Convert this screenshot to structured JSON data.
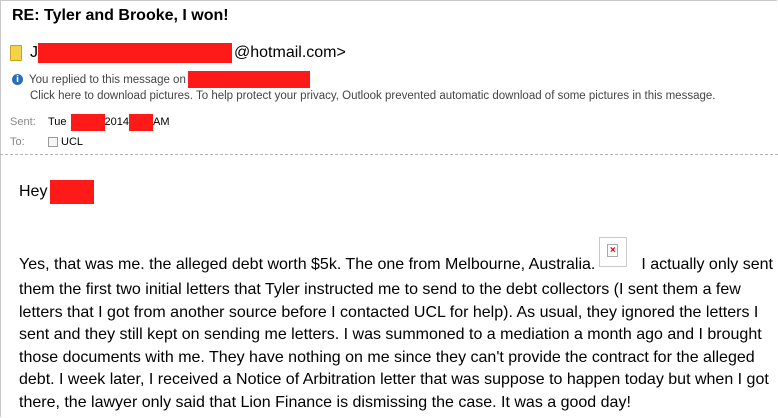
{
  "email": {
    "subject": "RE: Tyler and Brooke, I won!",
    "from_prefix": "J",
    "from_suffix": "@hotmail.com>",
    "info_replied": "You replied to this message on",
    "info_pictures": "Click here to download pictures. To help protect your privacy, Outlook prevented automatic download of some pictures in this message.",
    "sent_label": "Sent:",
    "sent_day": "Tue",
    "sent_year": "2014",
    "sent_ampm": "AM",
    "to_label": "To:",
    "to_value": "UCL",
    "greeting": "Hey",
    "body_line1_a": "Yes, that was me. the alleged debt worth $5k. The one from Melbourne, Australia.",
    "body_line1_b": "I actually only sent",
    "body_lines": [
      "them the first two initial letters that Tyler instructed me to send to the debt collectors (I sent them a few",
      "letters that I got from another source before I contacted UCL for help). As usual, they ignored the letters I",
      "sent and they still kept on sending me letters. I was  summoned to a mediation a month ago and I brought",
      "those documents with me. They have nothing on me since they can't provide the contract for the alleged",
      "debt. I week later, I received a Notice of Arbitration letter that was suppose to happen today but when I got",
      "there, the lawyer only said that Lion Finance is dismissing the case. It was a good day!"
    ]
  },
  "colors": {
    "redaction": "#ff1a1a",
    "info_icon": "#2a6db5"
  },
  "icons": [
    "contact-card-icon",
    "info-icon",
    "checkbox-icon",
    "broken-image-icon"
  ]
}
